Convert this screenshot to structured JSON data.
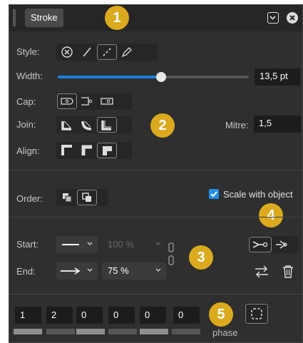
{
  "panel": {
    "title": "Stroke"
  },
  "labels": {
    "style": "Style:",
    "width": "Width:",
    "cap": "Cap:",
    "join": "Join:",
    "mitre": "Mitre:",
    "align": "Align:",
    "order": "Order:",
    "scale": "Scale with object",
    "start": "Start:",
    "end": "End:",
    "phase": "phase"
  },
  "width": {
    "value": "13,5 pt",
    "fraction": 0.54
  },
  "mitre": {
    "value": "1,5"
  },
  "scale_checked": true,
  "arrowheads": {
    "start_scale": "100 %",
    "end_scale": "75 %"
  },
  "dash": [
    "1",
    "2",
    "0",
    "0",
    "0",
    "0"
  ],
  "badges": [
    "1",
    "2",
    "3",
    "4",
    "5"
  ],
  "colors": {
    "panel": "#2f2f2f",
    "accent": "#1a7fe0",
    "badge": "#dbaa1e"
  },
  "icons": {
    "style": [
      "no-stroke-icon",
      "solid-line-icon",
      "dashed-line-icon",
      "pressure-brush-icon"
    ],
    "cap": [
      "butt-cap-icon",
      "round-cap-icon",
      "square-cap-icon"
    ],
    "join": [
      "miter-join-icon",
      "round-join-icon",
      "bevel-join-icon"
    ],
    "align": [
      "align-center-icon",
      "align-inside-icon",
      "align-outside-icon"
    ],
    "order": [
      "stroke-behind-fill-icon",
      "stroke-in-front-icon"
    ]
  }
}
